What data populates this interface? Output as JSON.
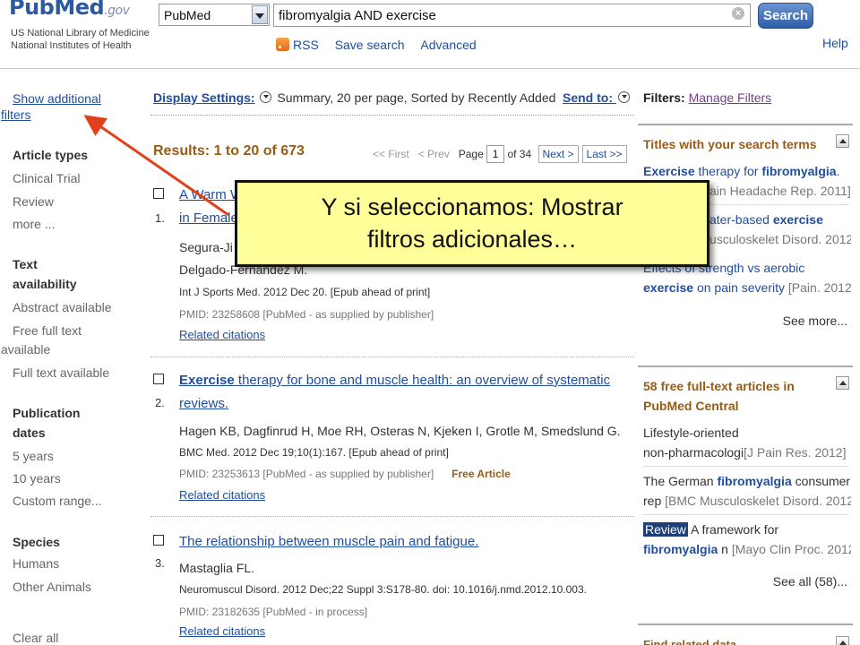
{
  "header": {
    "logo_main": "PubMed",
    "logo_gov": ".gov",
    "logo_line1": "US National Library of Medicine",
    "logo_line2": "National Institutes of Health",
    "database": "PubMed",
    "query": "fibromyalgia AND exercise",
    "clear_symbol": "×",
    "search_label": "Search",
    "rss_label": "RSS",
    "save_search_label": "Save search",
    "advanced_label": "Advanced",
    "help_label": "Help"
  },
  "sidebar": {
    "show_filters_1": "Show additional",
    "show_filters_2": "filters",
    "article_types_title": "Article types",
    "article_types": [
      "Clinical Trial",
      "Review",
      "more ..."
    ],
    "text_availability_title_1": "Text",
    "text_availability_title_2": "availability",
    "text_items": [
      "Abstract available",
      "Free full text",
      "available",
      "Full text available"
    ],
    "pub_dates_title_1": "Publication",
    "pub_dates_title_2": "dates",
    "pub_dates": [
      "5 years",
      "10 years",
      "Custom range..."
    ],
    "species_title": "Species",
    "species": [
      "Humans",
      "Other Animals"
    ],
    "clear_all": "Clear all"
  },
  "main": {
    "display_settings_label": "Display Settings:",
    "display_settings_value": "Summary, 20 per page, Sorted by Recently Added",
    "send_to_label": "Send to:",
    "results_label": "Results: 1 to 20 of 673",
    "pager": {
      "first": "<< First",
      "prev": "< Prev",
      "page_label": "Page",
      "page_value": "1",
      "of_label": "of 34",
      "next": "Next >",
      "last": "Last >>"
    },
    "results": [
      {
        "number": "1.",
        "title_1": "A Warm W",
        "title_2": "in Female",
        "authors_1": "Segura-Ji",
        "authors_2": "Delgado-Fernández M.",
        "journal": "Int J Sports Med. 2012 Dec 20. [Epub ahead of print]",
        "pmid": "PMID: 23258608 [PubMed - as supplied by publisher]",
        "related": "Related citations"
      },
      {
        "number": "2.",
        "title_bold": "Exercise",
        "title_1": " therapy for bone and muscle health: an overview of systematic",
        "title_2": "reviews.",
        "authors": "Hagen KB, Dagfinrud H, Moe RH, Osteras N, Kjeken I, Grotle M, Smedslund G.",
        "journal": "BMC Med. 2012 Dec 19;10(1):167. [Epub ahead of print]",
        "pmid": "PMID: 23253613 [PubMed - as supplied by publisher]",
        "free": "Free Article",
        "related": "Related citations"
      },
      {
        "number": "3.",
        "title_1": "The relationship between muscle pain and fatigue.",
        "authors": "Mastaglia FL.",
        "journal": "Neuromuscul Disord. 2012 Dec;22 Suppl 3:S178-80. doi: 10.1016/j.nmd.2012.10.003.",
        "pmid": "PMID: 23182635 [PubMed - in process]",
        "related": "Related citations"
      }
    ]
  },
  "right": {
    "filters_label": "Filters:",
    "manage_filters": "Manage Filters",
    "titles_box": {
      "title": "Titles with your search terms",
      "items": [
        {
          "b": "Exercise",
          "t": " therapy for ",
          "b2": "fibromyalgia",
          "t2": "."
        },
        {
          "src": "ain Headache Rep. 2011]"
        },
        {
          "t": "ater-based ",
          "b": "exercise"
        },
        {
          "src": "usculoskelet Disord. 2012]"
        },
        {
          "t": "Effects of strength vs aerobic"
        },
        {
          "b": "exercise",
          "t": " on pain severity",
          "src": " [Pain. 2012]"
        }
      ],
      "more": "See more..."
    },
    "free_box": {
      "title_1": "58 free full-text articles in",
      "title_2": "PubMed Central",
      "items": [
        {
          "t": "Lifestyle-oriented"
        },
        {
          "t": "non-pharmacologi",
          "src": "[J Pain Res. 2012]"
        },
        {
          "t": "The German ",
          "b": "fibromyalgia",
          "t2": " consumer"
        },
        {
          "t": "rep",
          "src": " [BMC Musculoskelet Disord. 2012]"
        },
        {
          "tag": "Review",
          "t": " A framework for"
        },
        {
          "b": "fibromyalgia",
          "t": " n",
          "src": " [Mayo Clin Proc. 2012]"
        }
      ],
      "more": "See all (58)..."
    },
    "find_related": "Find related data"
  },
  "callout": {
    "line1": "Y si seleccionamos: Mostrar",
    "line2": "filtros adicionales…"
  },
  "colors": {
    "link": "#1f4ea0",
    "accent_brown": "#9a5b14",
    "callout_bg": "#ffff99",
    "arrow": "#e0401a"
  }
}
